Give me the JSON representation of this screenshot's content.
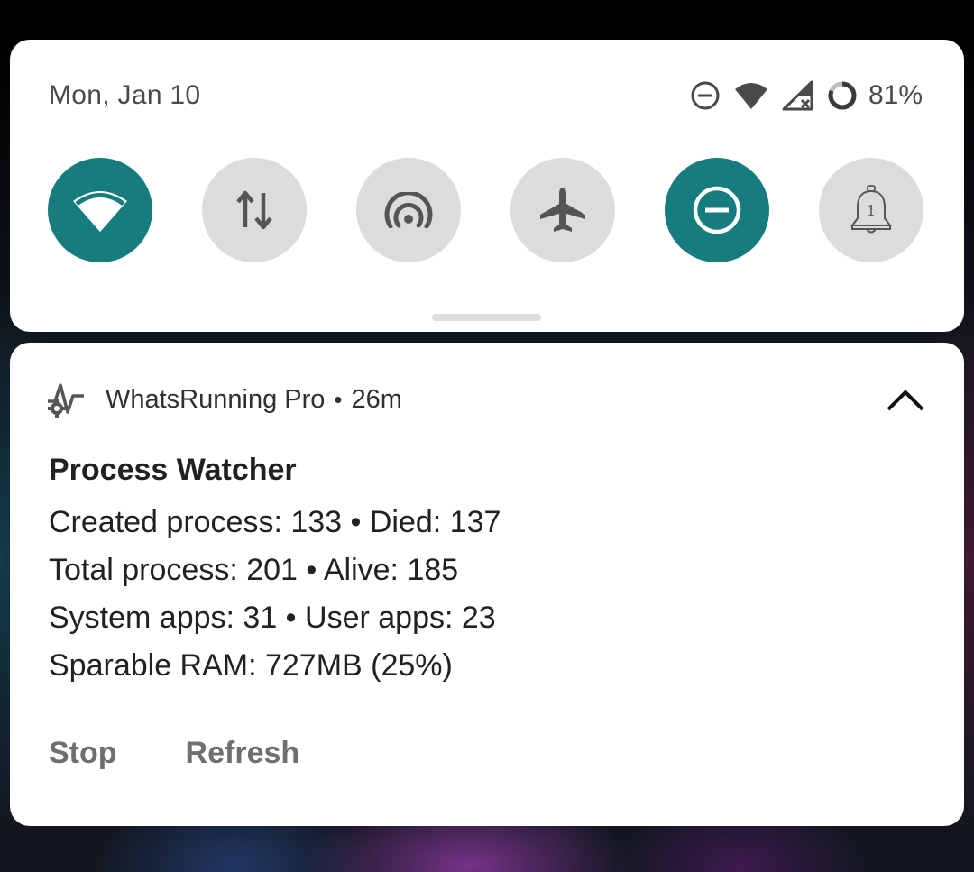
{
  "quick_settings": {
    "date": "Mon, Jan 10",
    "battery_percent": "81%",
    "battery_level": 0.81,
    "status_icons": [
      "do-not-disturb-icon",
      "wifi-icon",
      "cellular-no-service-icon",
      "battery-ring-icon"
    ],
    "tiles": [
      {
        "name": "wifi-tile",
        "icon": "wifi-icon",
        "active": true
      },
      {
        "name": "mobile-data-tile",
        "icon": "data-transfer-icon",
        "active": false
      },
      {
        "name": "hotspot-tile",
        "icon": "hotspot-icon",
        "active": false
      },
      {
        "name": "airplane-mode-tile",
        "icon": "airplane-icon",
        "active": false
      },
      {
        "name": "do-not-disturb-tile",
        "icon": "do-not-disturb-icon",
        "active": true
      },
      {
        "name": "alarm-tile",
        "icon": "bell-icon",
        "active": false,
        "badge": "1"
      }
    ],
    "accent_color": "#167c7e"
  },
  "notification": {
    "app_name": "WhatsRunning Pro",
    "separator": "•",
    "time_ago": "26m",
    "title": "Process Watcher",
    "lines": [
      "Created process: 133 • Died: 137",
      "Total process: 201 • Alive: 185",
      "System apps: 31 • User apps: 23",
      "Sparable RAM: 727MB (25%)"
    ],
    "actions": [
      "Stop",
      "Refresh"
    ]
  }
}
